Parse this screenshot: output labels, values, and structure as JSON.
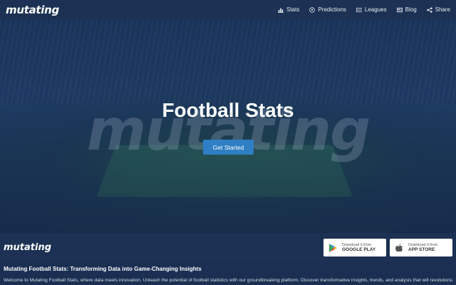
{
  "navbar": {
    "brand": "mutating",
    "items": [
      {
        "label": "Stats",
        "icon": "bar-chart-icon"
      },
      {
        "label": "Predictions",
        "icon": "soccer-ball-icon"
      },
      {
        "label": "Leagues",
        "icon": "list-icon"
      },
      {
        "label": "Blog",
        "icon": "newspaper-icon"
      },
      {
        "label": "Share",
        "icon": "share-icon"
      }
    ]
  },
  "hero": {
    "watermark": "mutating",
    "title": "Football Stats",
    "cta_label": "Get Started"
  },
  "footer": {
    "brand": "mutating",
    "google_play": {
      "small": "Download it from",
      "big": "GOOGLE PLAY"
    },
    "app_store": {
      "small": "Download it from",
      "big": "APP STORE"
    }
  },
  "article": {
    "title": "Mutating Football Stats: Transforming Data into Game-Changing Insights",
    "body": "Welcome to Mutating Football Stats, where data meets innovation. Unleash the potential of football statistics with our groundbreaking platform. Discover transformative insights, trends, and analysis that will revolutionize your"
  },
  "colors": {
    "navbar": "#1c3153",
    "accent": "#2f7fc4",
    "text": "#ffffff"
  }
}
